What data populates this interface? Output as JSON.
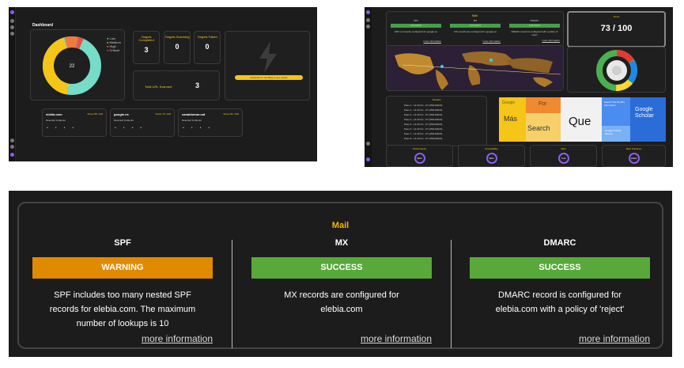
{
  "dashboard": {
    "title": "Dashboard",
    "donut_center": "22",
    "legend": [
      "Low",
      "Medium",
      "High",
      "Critical"
    ],
    "stats": [
      {
        "label": "Targets Completed",
        "value": "3"
      },
      {
        "label": "Targets Scanning",
        "value": "0"
      },
      {
        "label": "Targets Failed",
        "value": "0"
      }
    ],
    "urls": {
      "label": "Total URL Scanned",
      "value": "3"
    },
    "promo_button": "Subscribe to our Blog to see results",
    "domains": [
      {
        "name": "elebia.com",
        "score": "Score 85 / 100",
        "sub": "Detected Incidents"
      },
      {
        "name": "google.es",
        "score": "Score 76 / 100",
        "sub": "Detected Incidents"
      },
      {
        "name": "canaldomar.cat",
        "score": "Score 81 / 100",
        "sub": "Detected Incidents"
      }
    ],
    "incident_labels": [
      "Critical",
      "High",
      "Medium",
      "Low"
    ],
    "incident_values": [
      "0",
      "0",
      "0",
      "0"
    ]
  },
  "overview": {
    "mail_title": "Mail",
    "mini_columns": [
      {
        "head": "SPF",
        "status": "SUCCESS",
        "text": "SPF is correctly configured for google.es",
        "link": "more information"
      },
      {
        "head": "MX",
        "status": "SUCCESS",
        "text": "MX records are configured for google.es",
        "link": "more information"
      },
      {
        "head": "DMARC",
        "status": "SUCCESS",
        "text": "DMARC record is configured with a policy of reject",
        "link": "more information"
      }
    ],
    "score_label": "Score",
    "score": "73 / 100",
    "timeline_title": "Timeline",
    "timeline": [
      "Paso 1 - 14:40 hrs - 07 (25/04/2023)",
      "Paso 2 - 14:40 hrs - 07 (25/04/2023)",
      "Paso 3 - 14:40 hrs - 07 (25/04/2023)",
      "Paso 4 - 14:40 hrs - 07 (25/04/2023)",
      "Paso 5 - 14:40 hrs - 07 (25/04/2023)",
      "Paso 6 - 14:40 hrs - 07 (25/04/2023)",
      "Paso 7 - 14:40 hrs - 07 (25/04/2023)",
      "Paso 8 - 14:40 hrs - 07 (25/04/2023)"
    ],
    "wordcloud": [
      "Google",
      "For",
      "Más",
      "Search",
      "Que",
      "Search The World's Information",
      "Google Scholar",
      "Google Scholar Metrics"
    ],
    "gauges": [
      {
        "label": "Performance",
        "value": "98%"
      },
      {
        "label": "Accessibility",
        "value": "98%"
      },
      {
        "label": "SEO",
        "value": "71%"
      },
      {
        "label": "Best Practices",
        "value": "100%"
      }
    ]
  },
  "mail": {
    "title": "Mail",
    "columns": [
      {
        "head": "SPF",
        "status": "WARNING",
        "status_color": "#e08a00",
        "line1": "SPF includes too many nested SPF",
        "line2": "records for elebia.com. The maximum",
        "line3": "number of lookups is 10",
        "link": "more information"
      },
      {
        "head": "MX",
        "status": "SUCCESS",
        "status_color": "#58a93a",
        "line1": "MX records are configured for",
        "line2": "elebia.com",
        "line3": "",
        "link": "more information"
      },
      {
        "head": "DMARC",
        "status": "SUCCESS",
        "status_color": "#58a93a",
        "line1": "DMARC record is configured for",
        "line2": "elebia.com with a policy of 'reject'",
        "line3": "",
        "link": "more information"
      }
    ]
  },
  "colors": {
    "accent_yellow": "#f5b400",
    "success": "#58a93a",
    "warning": "#e08a00",
    "panel": "#1c1c1c"
  }
}
